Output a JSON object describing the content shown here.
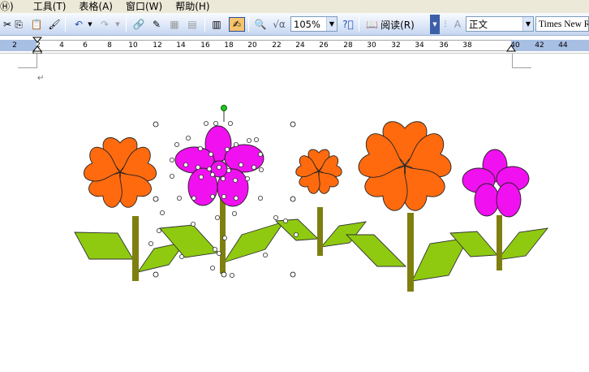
{
  "menu": {
    "items": [
      {
        "label": "Ⓗ)"
      },
      {
        "label": "工具(T)"
      },
      {
        "label": "表格(A)"
      },
      {
        "label": "窗口(W)"
      },
      {
        "label": "帮助(H)"
      }
    ]
  },
  "toolbar": {
    "zoom_value": "105%",
    "read_label": "阅读(R)",
    "style_value": "正文",
    "font_value": "Times New R"
  },
  "ruler": {
    "ticks": [
      "2",
      "2",
      "4",
      "6",
      "8",
      "10",
      "12",
      "14",
      "16",
      "18",
      "20",
      "22",
      "24",
      "26",
      "28",
      "30",
      "32",
      "34",
      "36",
      "38",
      "40",
      "42",
      "44"
    ]
  },
  "document": {
    "paragraph_mark": "↵"
  },
  "colors": {
    "orange_petal": "#ff6a0e",
    "magenta_petal": "#f010f0",
    "leaf_green": "#8fca10",
    "stem_olive": "#7f7f10",
    "toolbar_blue": "#dbe6f8"
  }
}
